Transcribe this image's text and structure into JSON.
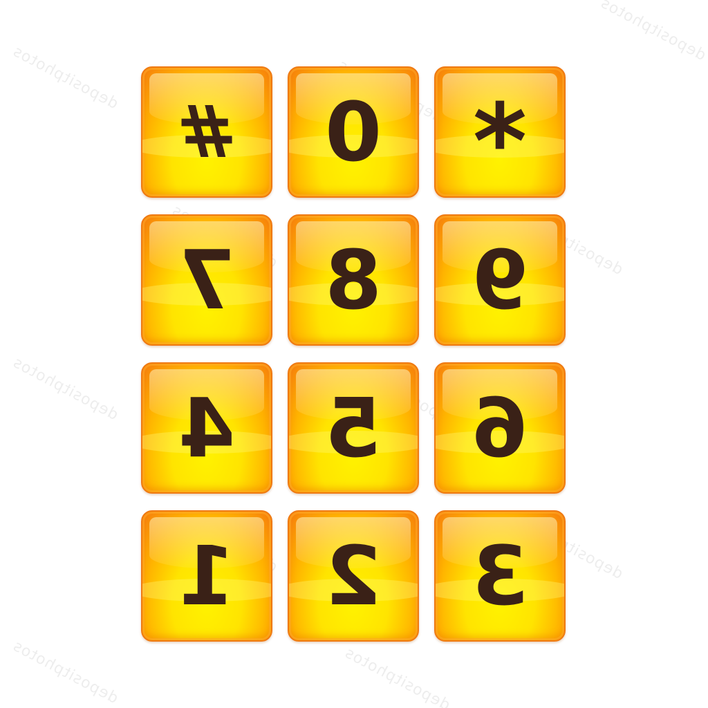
{
  "keypad": {
    "keys": [
      {
        "label": "#",
        "kind": "hash"
      },
      {
        "label": "0",
        "kind": "digit"
      },
      {
        "label": "*",
        "kind": "star"
      },
      {
        "label": "7",
        "kind": "digit"
      },
      {
        "label": "8",
        "kind": "digit"
      },
      {
        "label": "9",
        "kind": "digit"
      },
      {
        "label": "4",
        "kind": "digit"
      },
      {
        "label": "5",
        "kind": "digit"
      },
      {
        "label": "6",
        "kind": "digit"
      },
      {
        "label": "1",
        "kind": "digit"
      },
      {
        "label": "2",
        "kind": "digit"
      },
      {
        "label": "3",
        "kind": "digit"
      }
    ]
  },
  "watermark": {
    "text": "depositphotos"
  },
  "colors": {
    "key_center": "#fff200",
    "key_edge": "#f67d0e",
    "key_border": "#ef7a12",
    "glyph": "#3a2117",
    "background": "#ffffff"
  }
}
